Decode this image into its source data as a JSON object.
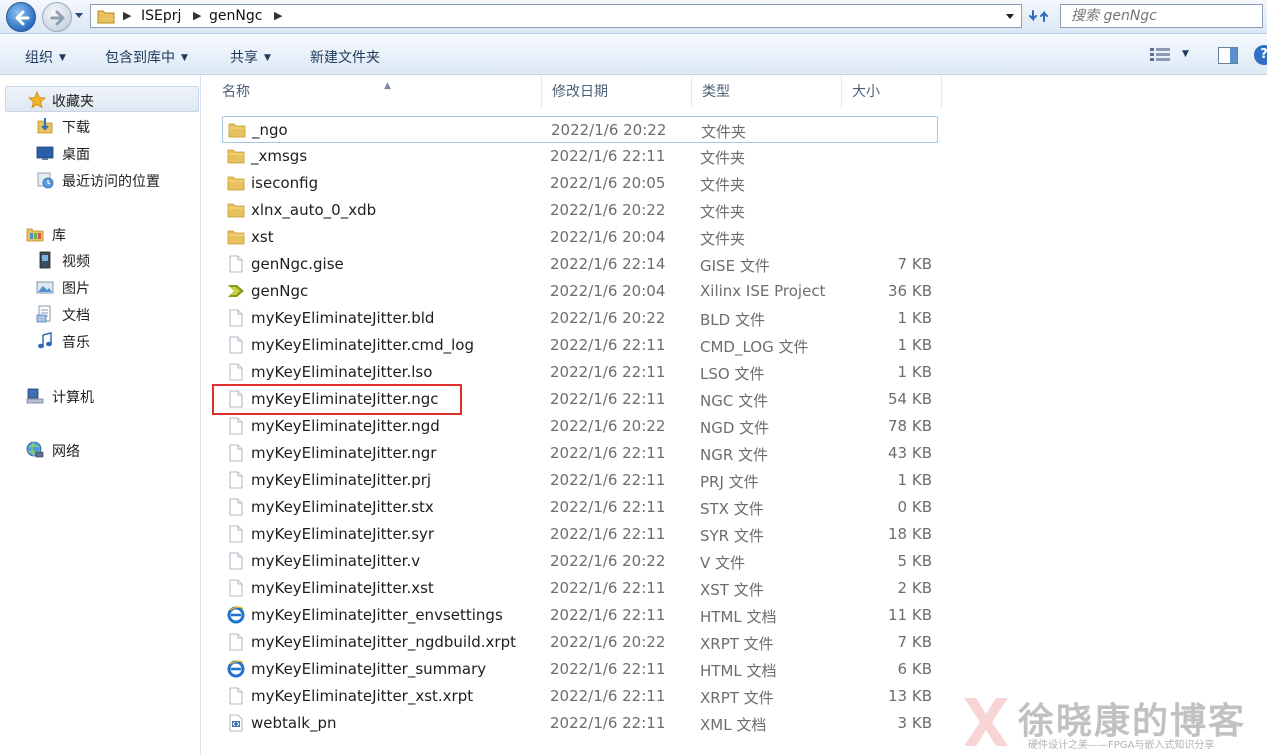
{
  "address": {
    "crumbs": [
      "ISEprj",
      "genNgc"
    ],
    "search_placeholder": "搜索 genNgc"
  },
  "toolbar": {
    "organize": "组织",
    "include_library": "包含到库中",
    "share": "共享",
    "new_folder": "新建文件夹"
  },
  "sidebar": {
    "favorites": "收藏夹",
    "downloads": "下载",
    "desktop": "桌面",
    "recent": "最近访问的位置",
    "libraries": "库",
    "videos": "视频",
    "pictures": "图片",
    "documents": "文档",
    "music": "音乐",
    "computer": "计算机",
    "network": "网络"
  },
  "columns": {
    "name": "名称",
    "date": "修改日期",
    "type": "类型",
    "size": "大小"
  },
  "files": [
    {
      "name": "_ngo",
      "date": "2022/1/6 20:22",
      "type": "文件夹",
      "size": "",
      "icon": "folder-icon"
    },
    {
      "name": "_xmsgs",
      "date": "2022/1/6 22:11",
      "type": "文件夹",
      "size": "",
      "icon": "folder-icon"
    },
    {
      "name": "iseconfig",
      "date": "2022/1/6 20:05",
      "type": "文件夹",
      "size": "",
      "icon": "folder-icon"
    },
    {
      "name": "xlnx_auto_0_xdb",
      "date": "2022/1/6 20:22",
      "type": "文件夹",
      "size": "",
      "icon": "folder-icon"
    },
    {
      "name": "xst",
      "date": "2022/1/6 20:04",
      "type": "文件夹",
      "size": "",
      "icon": "folder-icon"
    },
    {
      "name": "genNgc.gise",
      "date": "2022/1/6 22:14",
      "type": "GISE 文件",
      "size": "7 KB",
      "icon": "file-icon"
    },
    {
      "name": "genNgc",
      "date": "2022/1/6 20:04",
      "type": "Xilinx ISE Project",
      "size": "36 KB",
      "icon": "xilinx-icon"
    },
    {
      "name": "myKeyEliminateJitter.bld",
      "date": "2022/1/6 20:22",
      "type": "BLD 文件",
      "size": "1 KB",
      "icon": "file-icon"
    },
    {
      "name": "myKeyEliminateJitter.cmd_log",
      "date": "2022/1/6 22:11",
      "type": "CMD_LOG 文件",
      "size": "1 KB",
      "icon": "file-icon"
    },
    {
      "name": "myKeyEliminateJitter.lso",
      "date": "2022/1/6 22:11",
      "type": "LSO 文件",
      "size": "1 KB",
      "icon": "file-icon"
    },
    {
      "name": "myKeyEliminateJitter.ngc",
      "date": "2022/1/6 22:11",
      "type": "NGC 文件",
      "size": "54 KB",
      "icon": "file-icon"
    },
    {
      "name": "myKeyEliminateJitter.ngd",
      "date": "2022/1/6 20:22",
      "type": "NGD 文件",
      "size": "78 KB",
      "icon": "file-icon"
    },
    {
      "name": "myKeyEliminateJitter.ngr",
      "date": "2022/1/6 22:11",
      "type": "NGR 文件",
      "size": "43 KB",
      "icon": "file-icon"
    },
    {
      "name": "myKeyEliminateJitter.prj",
      "date": "2022/1/6 22:11",
      "type": "PRJ 文件",
      "size": "1 KB",
      "icon": "file-icon"
    },
    {
      "name": "myKeyEliminateJitter.stx",
      "date": "2022/1/6 22:11",
      "type": "STX 文件",
      "size": "0 KB",
      "icon": "file-icon"
    },
    {
      "name": "myKeyEliminateJitter.syr",
      "date": "2022/1/6 22:11",
      "type": "SYR 文件",
      "size": "18 KB",
      "icon": "file-icon"
    },
    {
      "name": "myKeyEliminateJitter.v",
      "date": "2022/1/6 20:22",
      "type": "V 文件",
      "size": "5 KB",
      "icon": "file-icon"
    },
    {
      "name": "myKeyEliminateJitter.xst",
      "date": "2022/1/6 22:11",
      "type": "XST 文件",
      "size": "2 KB",
      "icon": "file-icon"
    },
    {
      "name": "myKeyEliminateJitter_envsettings",
      "date": "2022/1/6 22:11",
      "type": "HTML 文档",
      "size": "11 KB",
      "icon": "ie-icon"
    },
    {
      "name": "myKeyEliminateJitter_ngdbuild.xrpt",
      "date": "2022/1/6 20:22",
      "type": "XRPT 文件",
      "size": "7 KB",
      "icon": "file-icon"
    },
    {
      "name": "myKeyEliminateJitter_summary",
      "date": "2022/1/6 22:11",
      "type": "HTML 文档",
      "size": "6 KB",
      "icon": "ie-icon"
    },
    {
      "name": "myKeyEliminateJitter_xst.xrpt",
      "date": "2022/1/6 22:11",
      "type": "XRPT 文件",
      "size": "13 KB",
      "icon": "file-icon"
    },
    {
      "name": "webtalk_pn",
      "date": "2022/1/6 22:11",
      "type": "XML 文档",
      "size": "3 KB",
      "icon": "xml-icon"
    }
  ],
  "watermark": {
    "title": "徐晓康的博客",
    "subtitle": "硬件设计之美——FPGA与嵌入式知识分享"
  },
  "colors": {
    "accent": "#1e395b",
    "highlight": "#e03131",
    "selection_border": "#a7c5e4"
  }
}
